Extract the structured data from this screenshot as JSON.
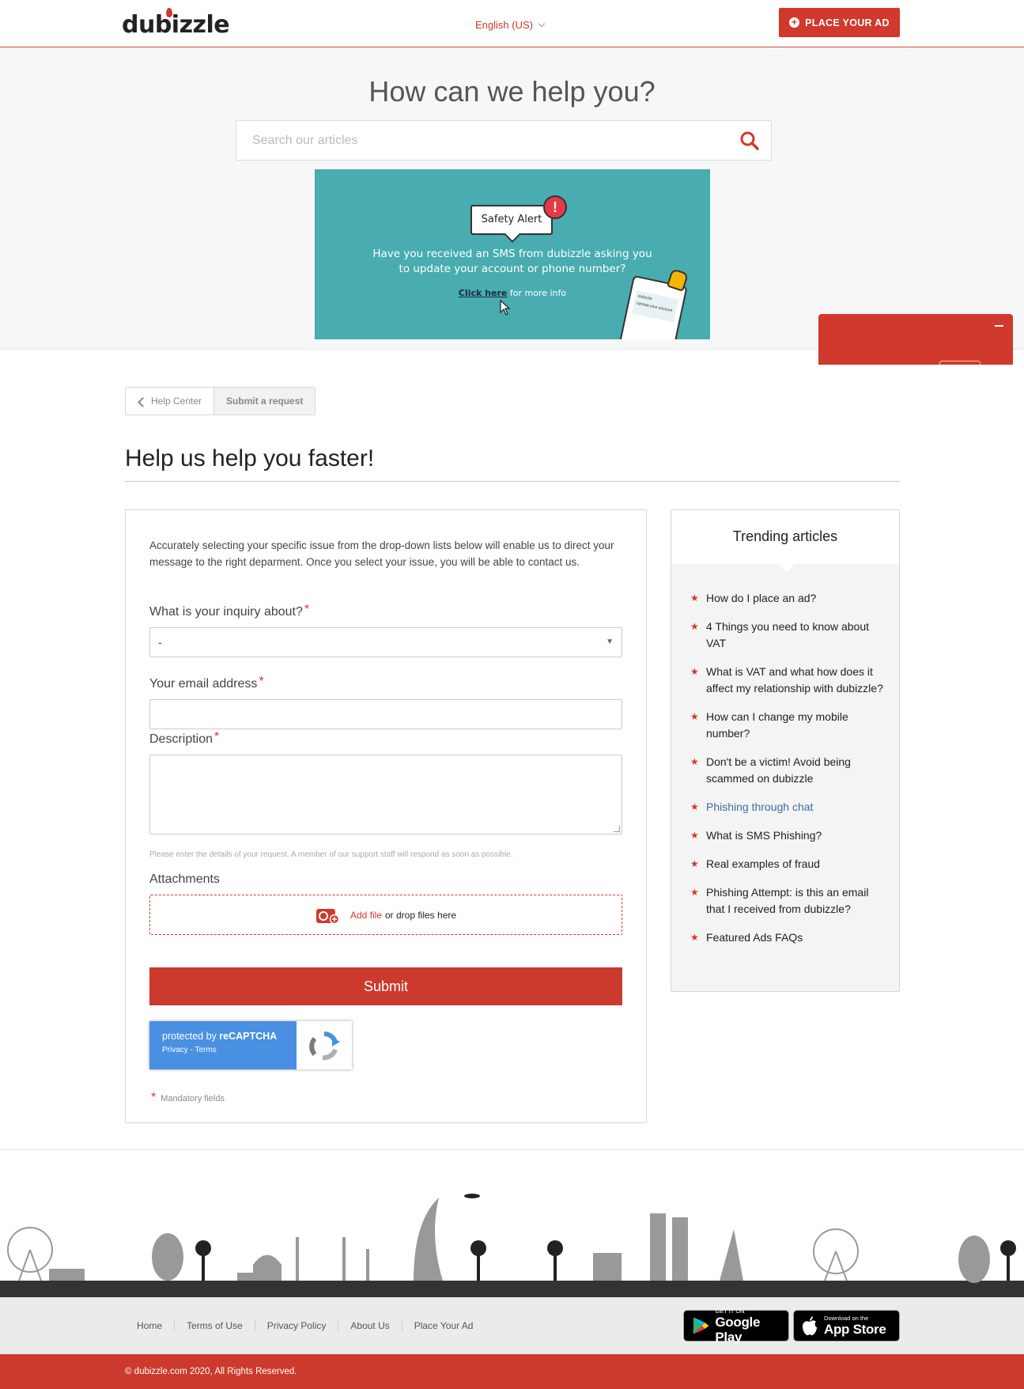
{
  "header": {
    "logo_text": "dubizzle",
    "language": "English (US)",
    "place_ad_label": "PLACE YOUR AD",
    "accent_color": "#d0392b"
  },
  "hero": {
    "title": "How can we help you?",
    "search_placeholder": "Search our articles",
    "search_icon": "search-icon"
  },
  "banner": {
    "badge": "Safety Alert",
    "text_line1": "Have you received an SMS from dubizzle asking you",
    "text_line2": "to update your account or phone number?",
    "link_text": "Click here",
    "link_suffix": " for more info",
    "phone_text1": "dubizzle",
    "phone_text2": "Update your account",
    "background": "#48acb0"
  },
  "breadcrumb": {
    "home": "Help Center",
    "current": "Submit a request"
  },
  "page": {
    "title": "Help us help you faster!"
  },
  "form": {
    "intro": "Accurately selecting your specific issue from the drop-down lists below will enable us to direct your message to the right deparment. Once you select your issue, you will be able to contact us.",
    "inquiry_label": "What is your inquiry about?",
    "inquiry_value": "-",
    "email_label": "Your email address",
    "email_value": "",
    "description_label": "Description",
    "description_value": "",
    "description_hint": "Please enter the details of your request. A member of our support staff will respond as soon as possible.",
    "attachments_label": "Attachments",
    "add_file": "Add file",
    "drop_text": "or drop files here",
    "submit_label": "Submit",
    "required_mark": "*",
    "mandatory_note": "Mandatory fields"
  },
  "recaptcha": {
    "protected_by": "protected by ",
    "brand": "reCAPTCHA",
    "links": "Privacy - Terms"
  },
  "trending": {
    "title": "Trending articles",
    "items": [
      "How do I place an ad?",
      "4 Things you need to know about VAT",
      "What is VAT and what how does it affect my relationship with dubizzle?",
      "How can I change my mobile number?",
      "Don't be a victim! Avoid being scammed on dubizzle",
      "Phishing through chat",
      "What is SMS Phishing?",
      "Real examples of fraud",
      "Phishing Attempt: is this an email that I received from dubizzle?",
      "Featured Ads FAQs"
    ]
  },
  "footer": {
    "links": [
      "Home",
      "Terms of Use",
      "Privacy Policy",
      "About Us",
      "Place Your Ad"
    ],
    "google_play_small": "GET IT ON",
    "google_play_big": "Google Play",
    "app_store_small": "Download on the",
    "app_store_big": "App Store",
    "copyright": "© dubizzle.com 2020, All Rights Reserved."
  }
}
